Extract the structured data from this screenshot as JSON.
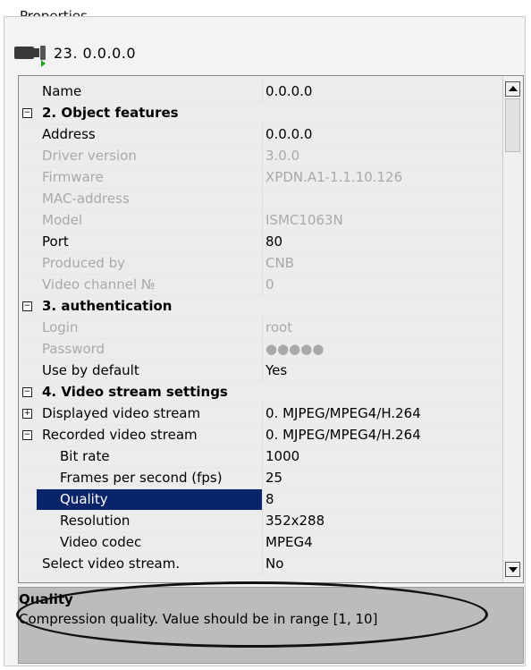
{
  "panel": {
    "title": "Properties"
  },
  "device": {
    "label": "23. 0.0.0.0",
    "icon": "camera-icon"
  },
  "properties": [
    {
      "key": "name",
      "name": "Name",
      "value": "0.0.0.0",
      "type": "row"
    },
    {
      "key": "sec2",
      "name": "2. Object features",
      "value": "",
      "type": "section",
      "expander": "⊟"
    },
    {
      "key": "address",
      "name": "Address",
      "value": "0.0.0.0",
      "type": "row"
    },
    {
      "key": "driver",
      "name": "Driver version",
      "value": "3.0.0",
      "type": "disabled"
    },
    {
      "key": "firmware",
      "name": "Firmware",
      "value": "XPDN.A1-1.1.10.126",
      "type": "disabled"
    },
    {
      "key": "mac",
      "name": "MAC-address",
      "value": "",
      "type": "disabled"
    },
    {
      "key": "model",
      "name": "Model",
      "value": "ISMC1063N",
      "type": "disabled"
    },
    {
      "key": "port",
      "name": "Port",
      "value": "80",
      "type": "row"
    },
    {
      "key": "produced",
      "name": "Produced by",
      "value": "CNB",
      "type": "disabled"
    },
    {
      "key": "vchan",
      "name": "Video channel №",
      "value": "0",
      "type": "disabled"
    },
    {
      "key": "sec3",
      "name": "3. authentication",
      "value": "",
      "type": "section",
      "expander": "⊟"
    },
    {
      "key": "login",
      "name": "Login",
      "value": "root",
      "type": "disabled"
    },
    {
      "key": "password",
      "name": "Password",
      "value": "●●●●●",
      "type": "disabled"
    },
    {
      "key": "usedefault",
      "name": "Use by default",
      "value": "Yes",
      "type": "row"
    },
    {
      "key": "sec4",
      "name": "4. Video stream settings",
      "value": "",
      "type": "section",
      "expander": "⊟"
    },
    {
      "key": "displayed",
      "name": "Displayed video stream",
      "value": "0. MJPEG/MPEG4/H.264",
      "type": "sub",
      "expander": "⊞"
    },
    {
      "key": "recorded",
      "name": "Recorded video stream",
      "value": "0. MJPEG/MPEG4/H.264",
      "type": "sub",
      "expander": "⊟"
    },
    {
      "key": "bitrate",
      "name": "Bit rate",
      "value": "1000",
      "type": "indent"
    },
    {
      "key": "fps",
      "name": "Frames per second (fps)",
      "value": "25",
      "type": "indent"
    },
    {
      "key": "quality",
      "name": "Quality",
      "value": "8",
      "type": "selected"
    },
    {
      "key": "resolution",
      "name": "Resolution",
      "value": "352x288",
      "type": "indent"
    },
    {
      "key": "codec",
      "name": "Video codec",
      "value": "MPEG4",
      "type": "indent"
    },
    {
      "key": "selectstream",
      "name": "Select video stream.",
      "value": "No",
      "type": "row"
    }
  ],
  "description": {
    "title": "Quality",
    "text": "Compression quality. Value should be in range [1, 10]"
  },
  "colors": {
    "selection": "#0a246a",
    "disabled_text": "#a9a9a9",
    "description_bg": "#bcbcbc"
  }
}
